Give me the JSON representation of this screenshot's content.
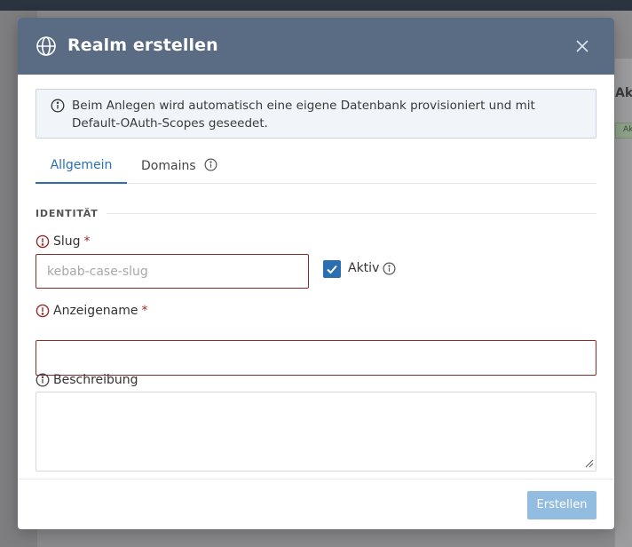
{
  "background": {
    "peek_text": "Ak",
    "peek_badge": "Ak"
  },
  "modal": {
    "title": "Realm erstellen",
    "icons": {
      "header": "globe-icon",
      "close": "close-icon"
    },
    "info": {
      "text": "Beim Anlegen wird automatisch eine eigene Datenbank provisioniert und mit Default-OAuth-Scopes geseedet.",
      "icon": "info-icon"
    },
    "tabs": [
      {
        "label": "Allgemein",
        "active": true
      },
      {
        "label": "Domains",
        "active": false,
        "icon": "info-icon"
      }
    ],
    "section": {
      "heading": "IDENTITÄT"
    },
    "fields": {
      "slug": {
        "label": "Slug",
        "required_mark": "*",
        "placeholder": "kebab-case-slug",
        "value": "",
        "status_icon": "error-icon"
      },
      "active": {
        "label": "Aktiv",
        "checked": true,
        "icon": "info-icon"
      },
      "display_name": {
        "label": "Anzeigename",
        "required_mark": "*",
        "value": "",
        "status_icon": "error-icon"
      },
      "description": {
        "label": "Beschreibung",
        "value": "",
        "status_icon": "info-icon"
      }
    },
    "footer": {
      "submit_label": "Erstellen"
    },
    "colors": {
      "header_bg": "#5a6b84",
      "accent": "#2a6fb0",
      "error": "#8f2a2a",
      "submit_disabled": "#93bde0"
    }
  }
}
